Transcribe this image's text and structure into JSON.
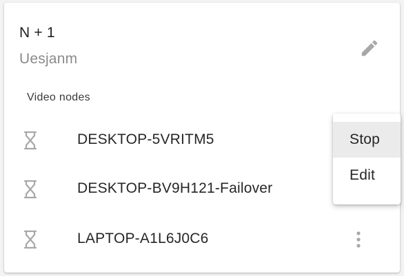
{
  "card": {
    "title": "N + 1",
    "subtitle": "Uesjanm",
    "edit_icon": "pencil-icon",
    "section_label": "Video nodes"
  },
  "nodes": [
    {
      "name": "DESKTOP-5VRITM5",
      "status_icon": "hourglass-icon"
    },
    {
      "name": "DESKTOP-BV9H121-Failover",
      "status_icon": "hourglass-icon"
    },
    {
      "name": "LAPTOP-A1L6J0C6",
      "status_icon": "hourglass-icon"
    }
  ],
  "context_menu": {
    "items": [
      {
        "label": "Stop",
        "highlighted": true
      },
      {
        "label": "Edit",
        "highlighted": false
      }
    ]
  },
  "colors": {
    "icon_gray": "#a8a8a8",
    "menu_highlight": "#ebebeb"
  }
}
